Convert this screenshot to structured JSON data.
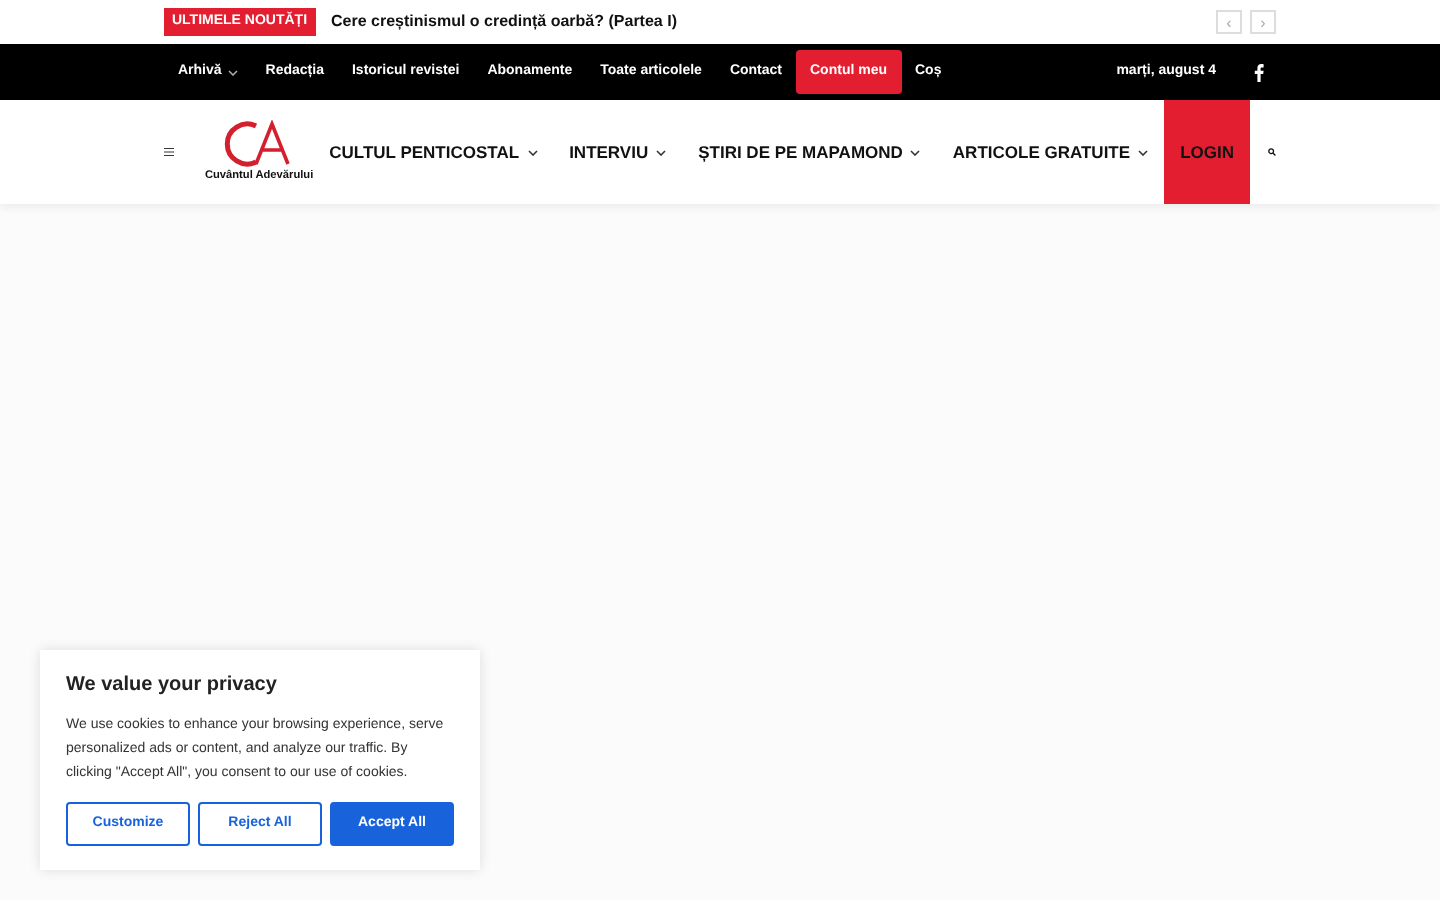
{
  "ticker": {
    "label": "ULTIMELE NOUTĂȚI",
    "headline": "Cere creștinismul o credință oarbă? (Partea I)",
    "prev": "‹",
    "next": "›"
  },
  "top_menu": [
    {
      "label": "Arhivă",
      "dropdown": true,
      "selected": false
    },
    {
      "label": "Redacția",
      "dropdown": false,
      "selected": false
    },
    {
      "label": "Istoricul revistei",
      "dropdown": false,
      "selected": false
    },
    {
      "label": "Abonamente",
      "dropdown": false,
      "selected": false
    },
    {
      "label": "Toate articolele",
      "dropdown": false,
      "selected": false
    },
    {
      "label": "Contact",
      "dropdown": false,
      "selected": false
    },
    {
      "label": "Contul meu",
      "dropdown": false,
      "selected": true
    },
    {
      "label": "Coș",
      "dropdown": false,
      "selected": false
    }
  ],
  "date": "marți, august 4",
  "logo": {
    "text": "Cuvântul Adevărului"
  },
  "main_menu": [
    {
      "label": "CULTUL PENTICOSTAL",
      "dropdown": true
    },
    {
      "label": "INTERVIU",
      "dropdown": true
    },
    {
      "label": "ȘTIRI DE PE MAPAMOND",
      "dropdown": true
    },
    {
      "label": "ARTICOLE GRATUITE",
      "dropdown": true
    }
  ],
  "login": "LOGIN",
  "cookie_banner": {
    "title": "We value your privacy",
    "text": "We use cookies to enhance your browsing experience, serve personalized ads or content, and analyze our traffic. By clicking \"Accept All\", you consent to our use of cookies.",
    "buttons": [
      {
        "label": "Customize",
        "kind": "outline"
      },
      {
        "label": "Reject All",
        "kind": "outline"
      },
      {
        "label": "Accept All",
        "kind": "primary"
      }
    ]
  }
}
